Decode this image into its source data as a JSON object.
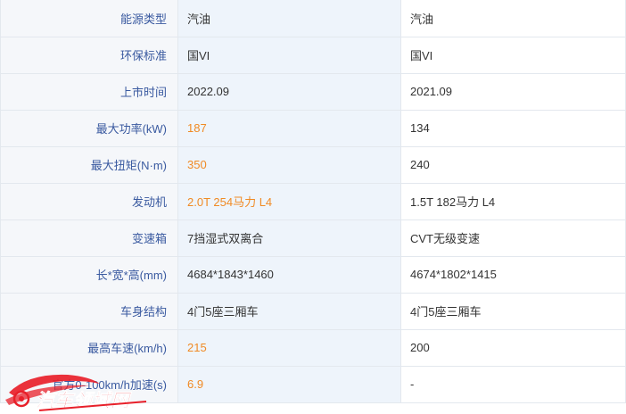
{
  "rows": [
    {
      "label": "能源类型",
      "a": "汽油",
      "b": "汽油",
      "a_hl": false
    },
    {
      "label": "环保标准",
      "a": "国VI",
      "b": "国VI",
      "a_hl": false
    },
    {
      "label": "上市时间",
      "a": "2022.09",
      "b": "2021.09",
      "a_hl": false
    },
    {
      "label": "最大功率(kW)",
      "a": "187",
      "b": "134",
      "a_hl": true
    },
    {
      "label": "最大扭矩(N·m)",
      "a": "350",
      "b": "240",
      "a_hl": true
    },
    {
      "label": "发动机",
      "a": "2.0T 254马力 L4",
      "b": "1.5T 182马力 L4",
      "a_hl": true
    },
    {
      "label": "变速箱",
      "a": "7挡湿式双离合",
      "b": "CVT无级变速",
      "a_hl": false
    },
    {
      "label": "长*宽*高(mm)",
      "a": "4684*1843*1460",
      "b": "4674*1802*1415",
      "a_hl": false
    },
    {
      "label": "车身结构",
      "a": "4门5座三厢车",
      "b": "4门5座三厢车",
      "a_hl": false
    },
    {
      "label": "最高车速(km/h)",
      "a": "215",
      "b": "200",
      "a_hl": true
    },
    {
      "label": "官方0-100km/h加速(s)",
      "a": "6.9",
      "b": "-",
      "a_hl": true
    }
  ],
  "watermark": {
    "text": "汽车领域网",
    "color": "#e8202a"
  }
}
